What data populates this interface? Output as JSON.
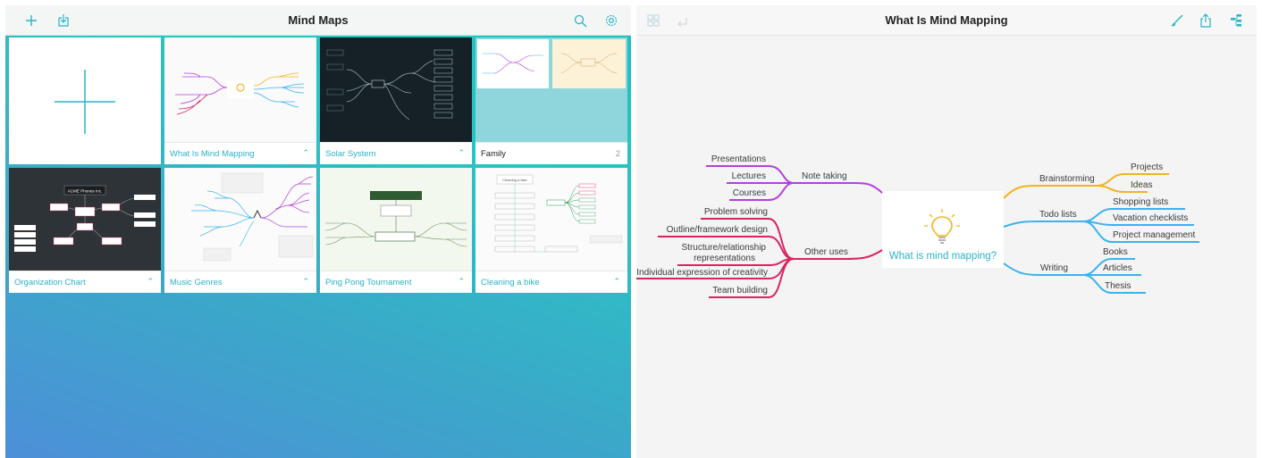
{
  "left_toolbar": {
    "title": "Mind Maps",
    "icons": [
      "plus-icon",
      "import-icon",
      "search-icon",
      "gear-icon"
    ]
  },
  "cards": [
    {
      "caption": "",
      "kind": "new"
    },
    {
      "caption": "What Is Mind Mapping",
      "kind": "map"
    },
    {
      "caption": "Solar System",
      "kind": "map"
    },
    {
      "caption": "Family",
      "count": "2",
      "kind": "folder"
    },
    {
      "caption": "Organization Chart",
      "kind": "map"
    },
    {
      "caption": "Music Genres",
      "kind": "map"
    },
    {
      "caption": "Ping Pong Tournament",
      "kind": "map"
    },
    {
      "caption": "Cleaning a bike",
      "kind": "map"
    }
  ],
  "thumb_text": {
    "acme": "ACME Phones Inc.",
    "cleaning": "Cleaning a bike"
  },
  "right_toolbar": {
    "title": "What Is Mind Mapping",
    "icons": [
      "grid-icon",
      "back-icon",
      "brush-icon",
      "share-icon",
      "outline-icon"
    ]
  },
  "mindmap": {
    "central": "What is mind mapping?",
    "branches": {
      "note_taking": {
        "label": "Note taking",
        "children": [
          "Presentations",
          "Lectures",
          "Courses"
        ]
      },
      "other_uses": {
        "label": "Other uses",
        "children": [
          "Problem solving",
          "Outline/framework design",
          "Structure/relationship",
          "representations",
          "Individual expression of creativity",
          "Team building"
        ]
      },
      "brainstorming": {
        "label": "Brainstorming",
        "children": [
          "Projects",
          "Ideas"
        ]
      },
      "todo_lists": {
        "label": "Todo lists",
        "children": [
          "Shopping lists",
          "Vacation checklists",
          "Project management"
        ]
      },
      "writing": {
        "label": "Writing",
        "children": [
          "Books",
          "Articles",
          "Thesis"
        ]
      }
    }
  },
  "colors": {
    "accent": "#2ab4c6",
    "purple": "#b43fe0",
    "pink": "#d8255f",
    "yellow": "#f2b41e",
    "blue": "#3cb2ee"
  }
}
